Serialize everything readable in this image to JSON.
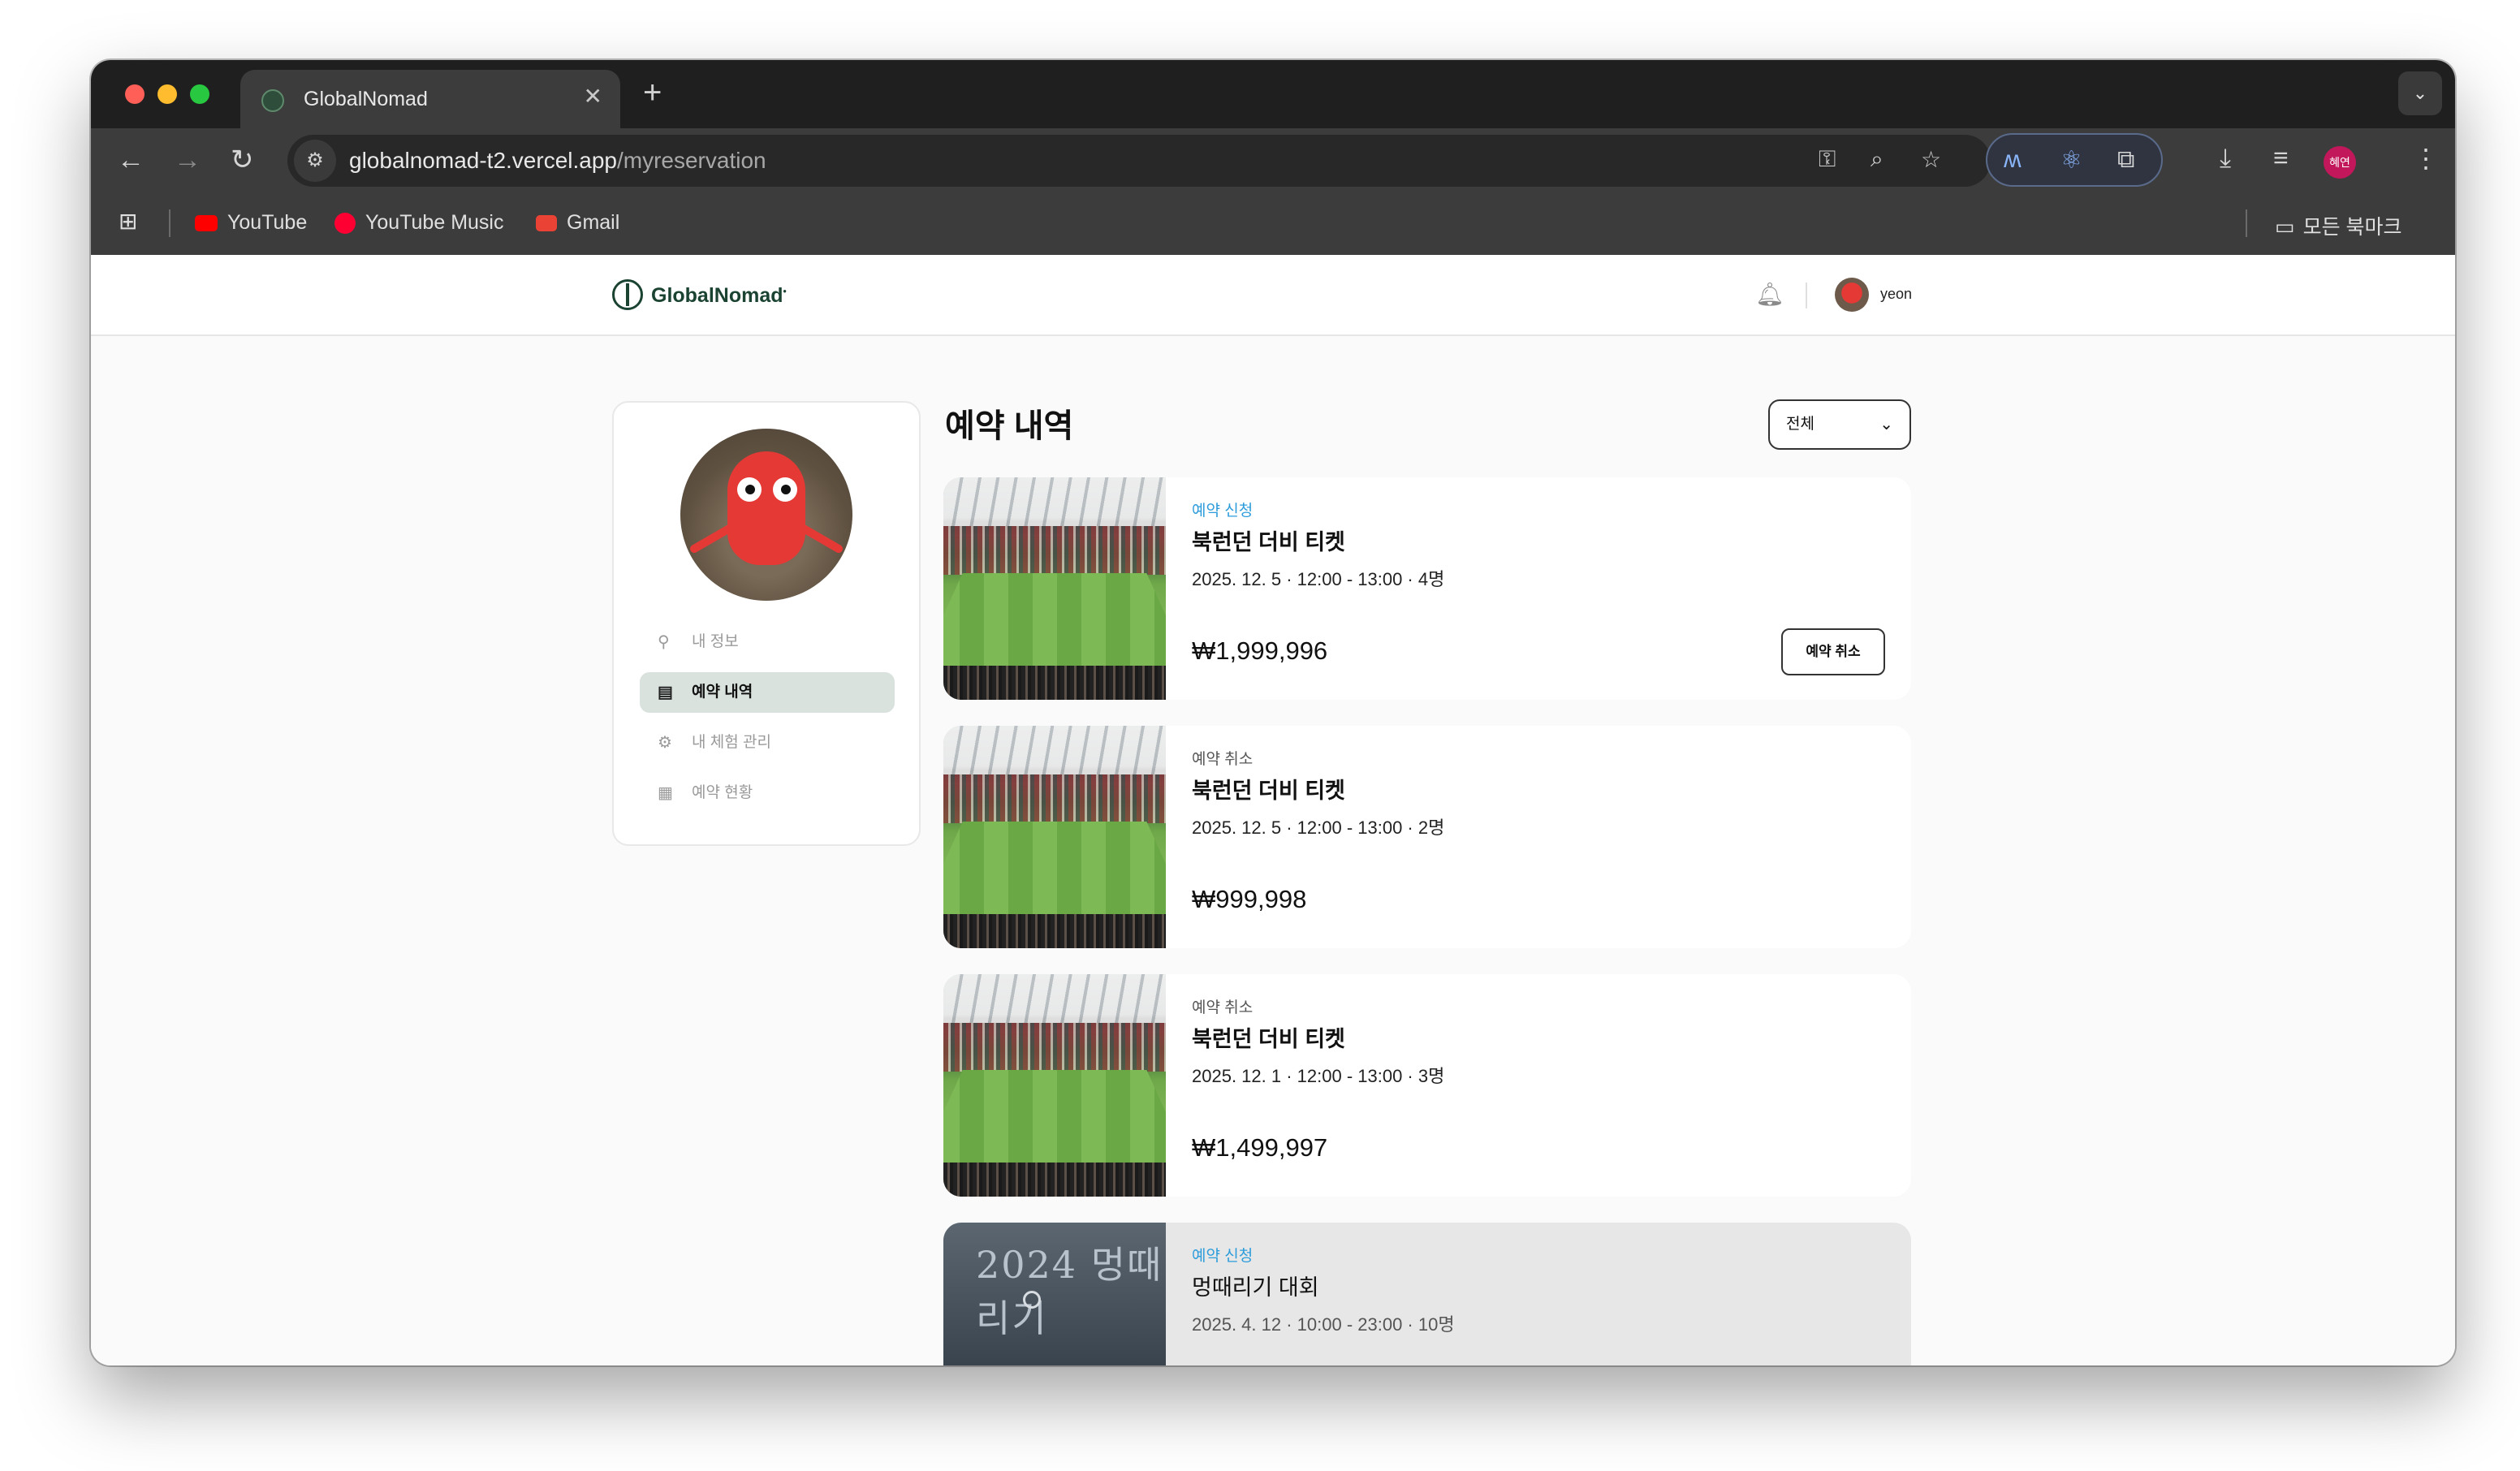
{
  "browser": {
    "tab_title": "GlobalNomad",
    "tab_close": "✕",
    "new_tab": "+",
    "url_host": "globalnomad-t2.vercel.app",
    "url_path": "/myreservation",
    "profile_initials": "혜연",
    "bookmarks": [
      {
        "label": "YouTube",
        "color": "#ff0000"
      },
      {
        "label": "YouTube Music",
        "color": "#ff0033"
      },
      {
        "label": "Gmail",
        "color": "#ea4335"
      }
    ],
    "all_bookmarks": "모든 북마크"
  },
  "header": {
    "logo_text": "GlobalNomad",
    "user_name": "yeon"
  },
  "sidebar": {
    "items": [
      {
        "label": "내 정보",
        "icon": "user-icon"
      },
      {
        "label": "예약 내역",
        "icon": "document-icon"
      },
      {
        "label": "내 체험 관리",
        "icon": "gear-icon"
      },
      {
        "label": "예약 현황",
        "icon": "calendar-icon"
      }
    ]
  },
  "main": {
    "title": "예약 내역",
    "filter_value": "전체",
    "cancel_button": "예약 취소",
    "reservations": [
      {
        "status": "예약 신청",
        "title": "북런던 더비 티켓",
        "meta": "2025. 12. 5 · 12:00 - 13:00 · 4명",
        "price": "₩1,999,996"
      },
      {
        "status": "예약 취소",
        "title": "북런던 더비 티켓",
        "meta": "2025. 12. 5 · 12:00 - 13:00 · 2명",
        "price": "₩999,998"
      },
      {
        "status": "예약 취소",
        "title": "북런던 더비 티켓",
        "meta": "2025. 12. 1 · 12:00 - 13:00 · 3명",
        "price": "₩1,499,997"
      },
      {
        "status": "예약 신청",
        "title": "멍때리기 대회",
        "meta": "2025. 4. 12 · 10:00 - 23:00 · 10명",
        "price": ""
      }
    ],
    "poster_text": "2024 멍때리기"
  },
  "colors": {
    "brand": "#1b4332",
    "status_applied": "#2d9cdb",
    "status_canceled": "#555555",
    "active_menu_bg": "#d9e2dd"
  }
}
